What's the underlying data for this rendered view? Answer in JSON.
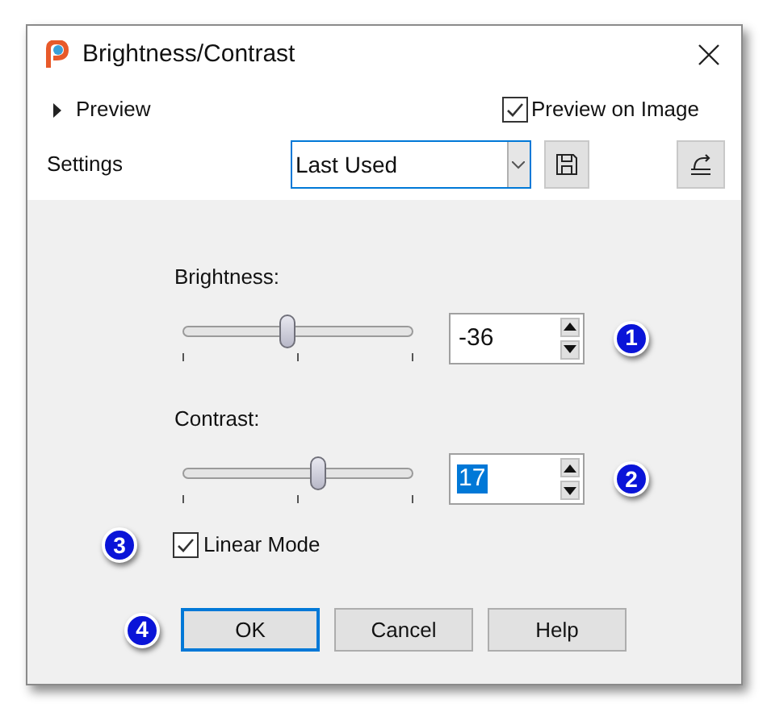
{
  "window": {
    "title": "Brightness/Contrast"
  },
  "preview": {
    "label": "Preview",
    "expanded": false
  },
  "preview_on_image": {
    "label": "Preview on Image",
    "checked": true
  },
  "settings": {
    "label": "Settings",
    "value": "Last Used"
  },
  "sliders": [
    {
      "label": "Brightness:",
      "level": 0.43,
      "value": "-36",
      "value_selected": false,
      "callout": "1"
    },
    {
      "label": "Contrast:",
      "level": 0.57,
      "value": "17",
      "value_selected": true,
      "callout": "2"
    }
  ],
  "linear_mode": {
    "label": "Linear Mode",
    "checked": true,
    "callout": "3"
  },
  "buttons": [
    {
      "label": "OK",
      "selected": true
    },
    {
      "label": "Cancel",
      "selected": false
    },
    {
      "label": "Help",
      "selected": false
    }
  ],
  "buttons_callout": "4"
}
